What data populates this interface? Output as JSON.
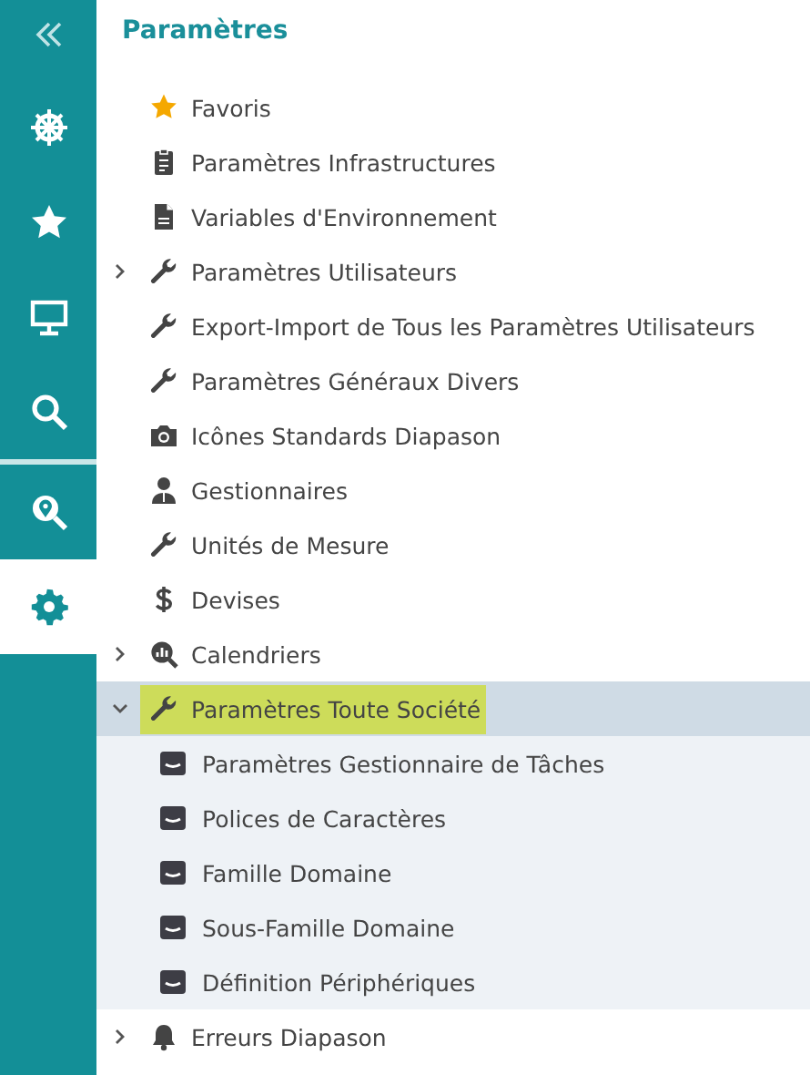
{
  "sidebar": {
    "items": [
      {
        "kind": "collapse",
        "selected": false
      },
      {
        "kind": "helm",
        "selected": false
      },
      {
        "kind": "star",
        "selected": false
      },
      {
        "kind": "monitor",
        "selected": false
      },
      {
        "kind": "search",
        "selected": false
      },
      {
        "kind": "map-search",
        "selected": false
      },
      {
        "kind": "gear",
        "selected": true
      }
    ]
  },
  "panel": {
    "title": "Paramètres",
    "tree": [
      {
        "label": "Favoris",
        "kind": "star",
        "selected": false
      },
      {
        "label": "Paramètres Infrastructures",
        "kind": "clipboard",
        "selected": false
      },
      {
        "label": "Variables d'Environnement",
        "kind": "document",
        "selected": false
      },
      {
        "label": "Paramètres Utilisateurs",
        "kind": "wrench",
        "expanded": false,
        "selected": false
      },
      {
        "label": "Export-Import de Tous les Paramètres Utilisateurs",
        "kind": "wrench",
        "selected": false
      },
      {
        "label": "Paramètres Généraux Divers",
        "kind": "wrench",
        "selected": false
      },
      {
        "label": "Icônes Standards Diapason",
        "kind": "camera",
        "selected": false
      },
      {
        "label": "Gestionnaires",
        "kind": "user",
        "selected": false
      },
      {
        "label": "Unités de Mesure",
        "kind": "wrench",
        "selected": false
      },
      {
        "label": "Devises",
        "kind": "dollar",
        "selected": false
      },
      {
        "label": "Calendriers",
        "kind": "chart-search",
        "expanded": false,
        "selected": false
      },
      {
        "label": "Paramètres Toute Société",
        "kind": "wrench",
        "expanded": true,
        "selected": true,
        "children": [
          {
            "label": "Paramètres Gestionnaire de Tâches",
            "kind": "drive",
            "selected": false
          },
          {
            "label": "Polices de Caractères",
            "kind": "drive",
            "selected": false
          },
          {
            "label": "Famille Domaine",
            "kind": "drive",
            "selected": false
          },
          {
            "label": "Sous-Famille Domaine",
            "kind": "drive",
            "selected": false
          },
          {
            "label": "Définition Périphériques",
            "kind": "drive",
            "selected": false
          }
        ]
      },
      {
        "label": "Erreurs Diapason",
        "kind": "bell",
        "expanded": false,
        "selected": false
      }
    ]
  }
}
